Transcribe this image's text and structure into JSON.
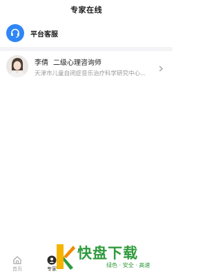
{
  "header": {
    "title": "专家在线"
  },
  "platform_service": {
    "label": "平台客服",
    "icon": "headset-icon",
    "icon_color": "#2f86f6"
  },
  "experts": [
    {
      "name": "李倩",
      "title": "二级心理咨询师",
      "organization": "天津市儿童自闭症音乐治疗科学研究中心..."
    }
  ],
  "tab_bar": {
    "items": [
      {
        "label": "首页",
        "icon": "home-icon",
        "active": false
      },
      {
        "label": "专家",
        "icon": "expert-icon",
        "active": true
      }
    ]
  },
  "watermark": {
    "title": "快盘下载",
    "subtitle": "绿色 · 安全 · 高速",
    "color": "#2f9a3c"
  }
}
